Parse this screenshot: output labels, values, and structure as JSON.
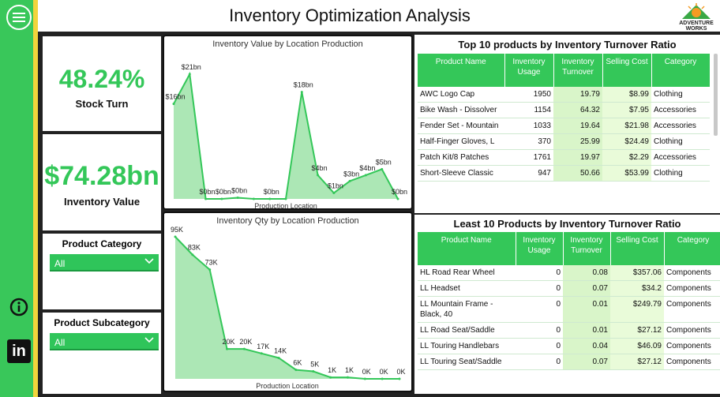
{
  "header": {
    "title": "Inventory Optimization Analysis",
    "logo_line1": "ADVENTURE",
    "logo_line2": "WORKS"
  },
  "nav": {
    "linkedin_label": "in"
  },
  "kpis": {
    "stock_turn_value": "48.24%",
    "stock_turn_label": "Stock Turn",
    "inventory_value": "$74.28bn",
    "inventory_value_label": "Inventory Value"
  },
  "slicers": {
    "category_title": "Product Category",
    "category_value": "All",
    "subcategory_title": "Product Subcategory",
    "subcategory_value": "All"
  },
  "colors": {
    "accent": "#34c759",
    "accent_light": "#9ee3a8",
    "sidebar": "#39c75a",
    "stripe": "#f2d43c"
  },
  "chart_data": [
    {
      "type": "area",
      "title": "Inventory Value by Location Production",
      "xlabel": "Production Location",
      "values": [
        16,
        21,
        0,
        0,
        0.2,
        0,
        0,
        0,
        18,
        4,
        1,
        3,
        4,
        5,
        0
      ],
      "data_labels": [
        "$16bn",
        "$21bn",
        "$0bn",
        "$0bn",
        "$0bn",
        "",
        "$0bn",
        "",
        "$18bn",
        "$4bn",
        "$1bn",
        "$3bn",
        "$4bn",
        "$5bn",
        "$0bn"
      ]
    },
    {
      "type": "area",
      "title": "Inventory Qty by Location Production",
      "xlabel": "Production Location",
      "values": [
        95,
        83,
        73,
        20,
        20,
        17,
        14,
        6,
        5,
        1,
        1,
        0,
        0,
        0
      ],
      "data_labels": [
        "95K",
        "83K",
        "73K",
        "20K",
        "20K",
        "17K",
        "14K",
        "6K",
        "5K",
        "1K",
        "1K",
        "0K",
        "0K",
        "0K"
      ]
    }
  ],
  "top_table": {
    "title": "Top 10 products by Inventory Turnover Ratio",
    "columns": [
      "Product Name",
      "Inventory Usage",
      "Inventory Turnover",
      "Selling Cost",
      "Category"
    ],
    "rows": [
      [
        "AWC Logo Cap",
        "1950",
        "19.79",
        "$8.99",
        "Clothing"
      ],
      [
        "Bike Wash - Dissolver",
        "1154",
        "64.32",
        "$7.95",
        "Accessories"
      ],
      [
        "Fender Set - Mountain",
        "1033",
        "19.64",
        "$21.98",
        "Accessories"
      ],
      [
        "Half-Finger Gloves, L",
        "370",
        "25.99",
        "$24.49",
        "Clothing"
      ],
      [
        "Patch Kit/8 Patches",
        "1761",
        "19.97",
        "$2.29",
        "Accessories"
      ],
      [
        "Short-Sleeve Classic",
        "947",
        "50.66",
        "$53.99",
        "Clothing"
      ]
    ]
  },
  "least_table": {
    "title": "Least 10 Products by Inventory Turnover Ratio",
    "columns": [
      "Product Name",
      "Inventory Usage",
      "Inventory Turnover",
      "Selling Cost",
      "Category"
    ],
    "rows": [
      [
        "HL Road Rear Wheel",
        "0",
        "0.08",
        "$357.06",
        "Components"
      ],
      [
        "LL Headset",
        "0",
        "0.07",
        "$34.2",
        "Components"
      ],
      [
        "LL Mountain Frame - Black, 40",
        "0",
        "0.01",
        "$249.79",
        "Components"
      ],
      [
        "LL Road Seat/Saddle",
        "0",
        "0.01",
        "$27.12",
        "Components"
      ],
      [
        "LL Touring Handlebars",
        "0",
        "0.04",
        "$46.09",
        "Components"
      ],
      [
        "LL Touring Seat/Saddle",
        "0",
        "0.07",
        "$27.12",
        "Components"
      ]
    ]
  }
}
